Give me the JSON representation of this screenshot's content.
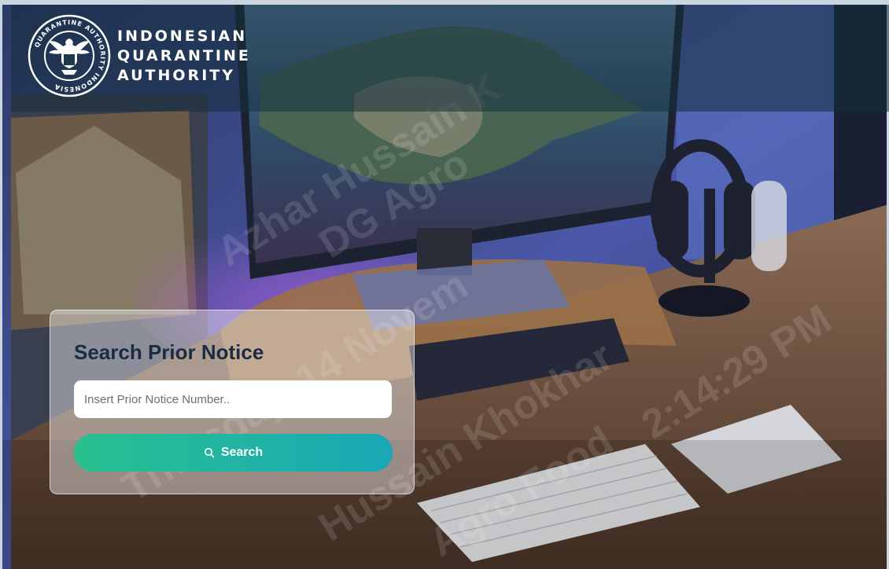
{
  "brand": {
    "line1": "INDONESIAN",
    "line2": "QUARANTINE",
    "line3": "AUTHORITY",
    "seal_text": "QUARANTINE AUTHORITY INDONESIA"
  },
  "search": {
    "title": "Search Prior Notice",
    "placeholder": "Insert Prior Notice Number..",
    "button_label": "Search",
    "button_icon": "search-icon"
  },
  "watermark": {
    "lines": [
      "Azhar Hussain K",
      "DG Agro",
      "Thursday, 14 Novem",
      "Hussain Khokhar",
      "Agro Food",
      "2:14:29 PM"
    ]
  },
  "colors": {
    "button_start": "#29c08f",
    "button_end": "#1aa8b6",
    "title": "#1a2b42",
    "header_overlay": "#142d3c"
  }
}
